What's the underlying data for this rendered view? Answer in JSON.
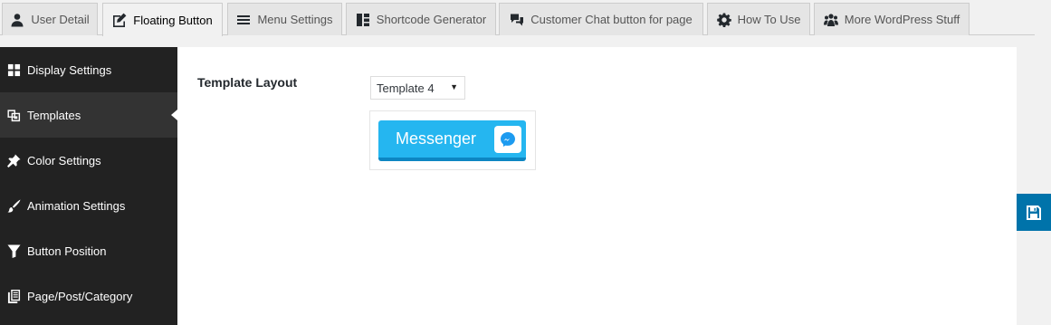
{
  "tabs": [
    {
      "label": "User Detail",
      "icon": "user-icon"
    },
    {
      "label": "Floating Button",
      "icon": "edit-icon",
      "active": true
    },
    {
      "label": "Menu Settings",
      "icon": "menu-icon"
    },
    {
      "label": "Shortcode Generator",
      "icon": "shortcode-icon"
    },
    {
      "label": "Customer Chat button for page",
      "icon": "chat-icon"
    },
    {
      "label": "How To Use",
      "icon": "gear-icon"
    },
    {
      "label": "More WordPress Stuff",
      "icon": "users-icon"
    }
  ],
  "sidebar": {
    "items": [
      {
        "label": "Display Settings",
        "icon": "grid-icon"
      },
      {
        "label": "Templates",
        "icon": "templates-icon",
        "active": true
      },
      {
        "label": "Color Settings",
        "icon": "pin-icon"
      },
      {
        "label": "Animation Settings",
        "icon": "brush-icon"
      },
      {
        "label": "Button Position",
        "icon": "funnel-icon"
      },
      {
        "label": "Page/Post/Category",
        "icon": "pages-icon"
      }
    ]
  },
  "main": {
    "template_layout_label": "Template Layout",
    "template_select_value": "Template 4",
    "preview_button_label": "Messenger"
  },
  "colors": {
    "sidebar_bg": "#222222",
    "sidebar_active_bg": "#333333",
    "messenger_blue": "#25b6f0",
    "save_button_bg": "#0073aa"
  },
  "save_button_icon": "save-icon"
}
